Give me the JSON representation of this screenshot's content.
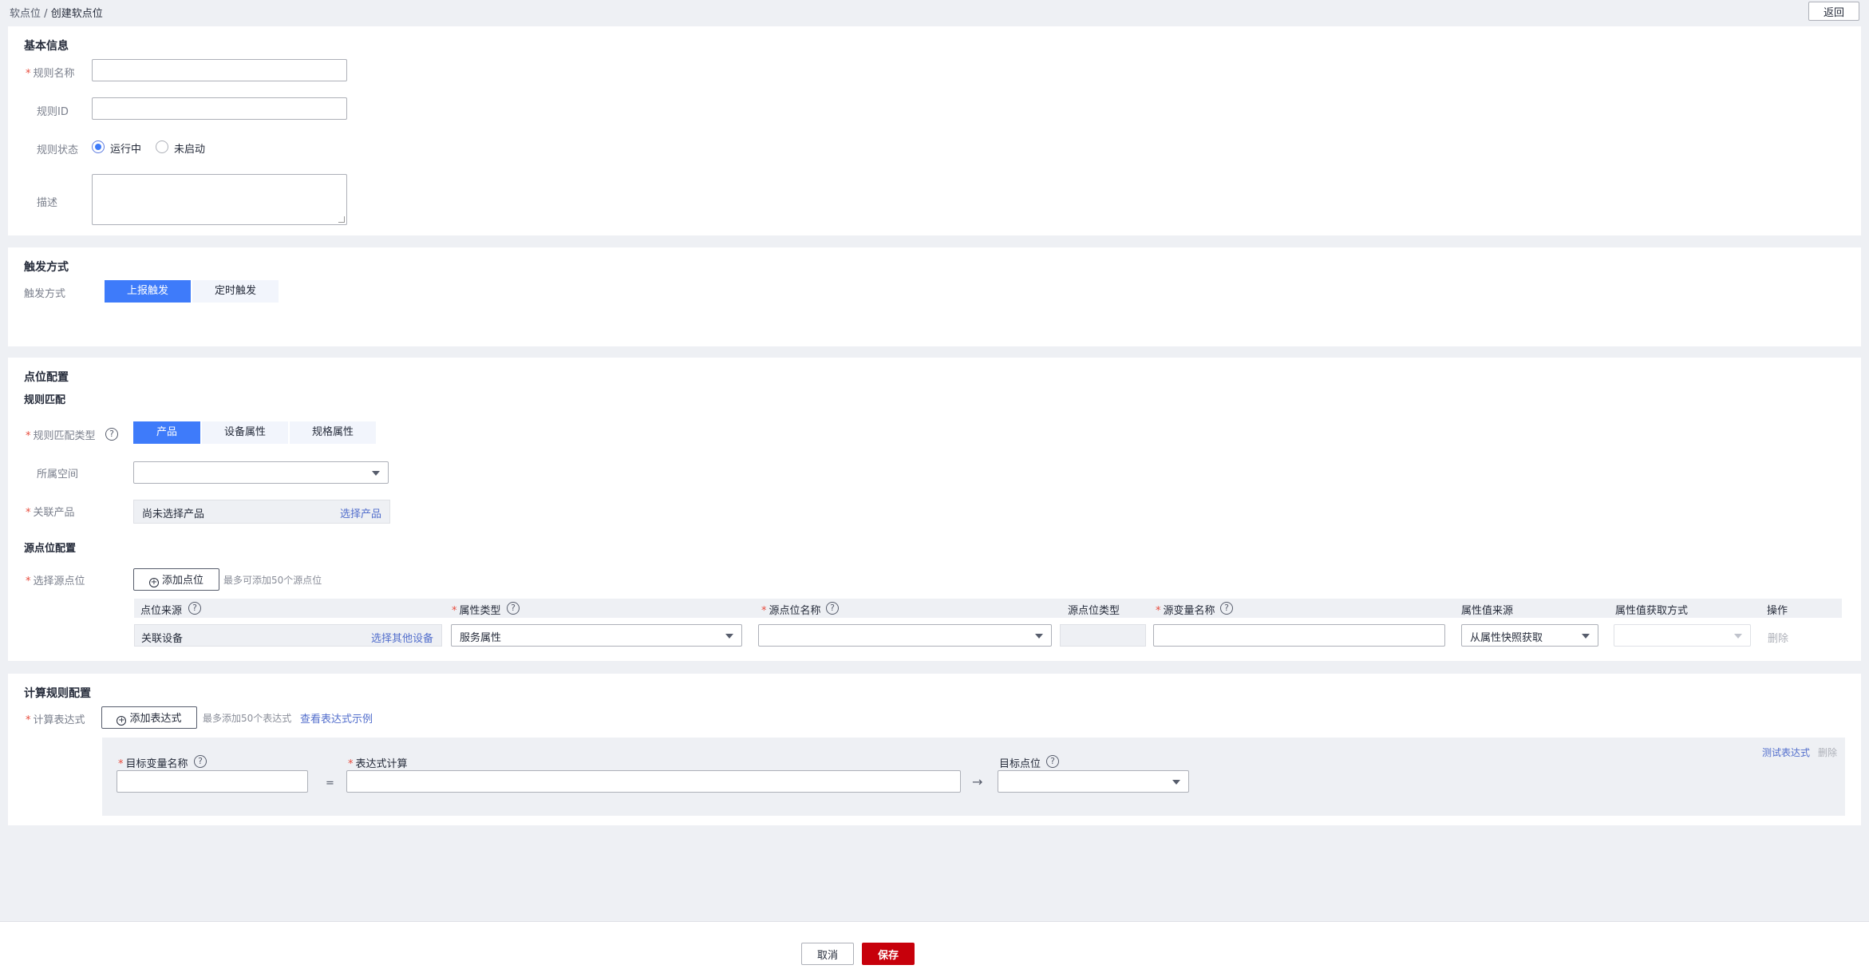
{
  "breadcrumb": {
    "parent": "软点位",
    "separator": "/",
    "current": "创建软点位"
  },
  "back_label": "返回",
  "basic": {
    "title": "基本信息",
    "rule_name_label": "规则名称",
    "rule_id_label": "规则ID",
    "status_label": "规则状态",
    "status_running": "运行中",
    "status_stopped": "未启动",
    "desc_label": "描述"
  },
  "trigger": {
    "title": "触发方式",
    "label": "触发方式",
    "opt1": "上报触发",
    "opt2": "定时触发"
  },
  "point": {
    "title": "点位配置",
    "subtitle": "规则匹配",
    "match_type_label": "规则匹配类型",
    "match_opt1": "产品",
    "match_opt2": "设备属性",
    "match_opt3": "规格属性",
    "space_label": "所属空间",
    "product_label": "关联产品",
    "product_value": "尚未选择产品",
    "product_link": "选择产品",
    "source_title": "源点位配置",
    "select_source_label": "选择源点位",
    "add_point_label": "添加点位",
    "add_point_hint": "最多可添加50个源点位",
    "table": {
      "columns": [
        "点位来源",
        "属性类型",
        "源点位名称",
        "源点位类型",
        "源变量名称",
        "属性值来源",
        "属性值获取方式",
        "操作"
      ],
      "row": {
        "source": "关联设备",
        "source_link": "选择其他设备",
        "attr_type": "服务属性",
        "value_source": "从属性快照获取",
        "op": "删除"
      }
    }
  },
  "calc": {
    "title": "计算规则配置",
    "expr_label": "计算表达式",
    "add_expr_label": "添加表达式",
    "add_expr_hint": "最多添加50个表达式",
    "example_link": "查看表达式示例",
    "test_link": "测试表达式",
    "delete_link": "删除",
    "target_var_label": "目标变量名称",
    "expr_calc_label": "表达式计算",
    "target_point_label": "目标点位",
    "equals": "=",
    "arrow": "→"
  },
  "footer": {
    "cancel": "取消",
    "save": "保存"
  },
  "colors": {
    "primary": "#3e7bfa",
    "danger": "#c7000b",
    "link": "#526ecc",
    "required": "#e84c3d"
  }
}
